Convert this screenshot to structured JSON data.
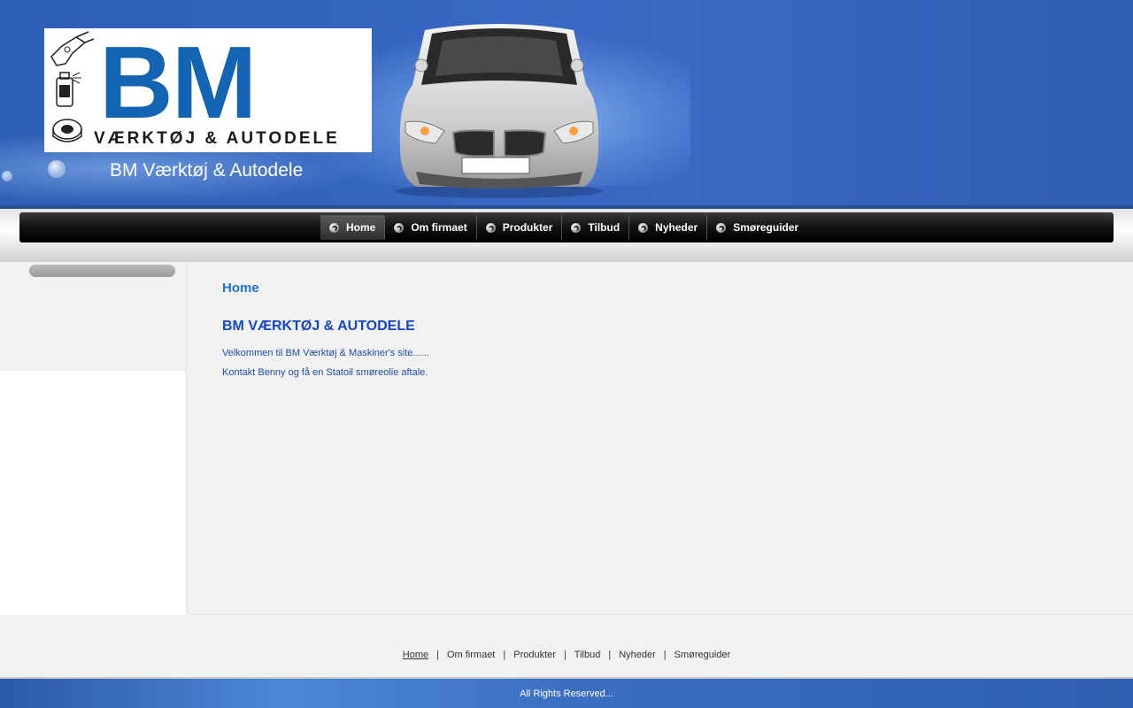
{
  "header": {
    "logo_text": "BM",
    "logo_subtitle": "VÆRKTØJ & AUTODELE",
    "site_name": "BM Værktøj & Autodele"
  },
  "nav": {
    "items": [
      {
        "label": "Home",
        "active": true
      },
      {
        "label": "Om firmaet"
      },
      {
        "label": "Produkter"
      },
      {
        "label": "Tilbud"
      },
      {
        "label": "Nyheder"
      },
      {
        "label": "Smøreguider"
      }
    ]
  },
  "main": {
    "page_title": "Home",
    "heading": "BM VÆRKTØJ & AUTODELE",
    "paragraphs": [
      "Velkommen til BM Værktøj & Maskiner's site......",
      "Kontakt Benny og få en Statoil smøreolie aftale."
    ]
  },
  "footer": {
    "links": [
      "Home",
      "Om firmaet",
      "Produkter",
      "Tilbud",
      "Nyheder",
      "Smøreguider"
    ],
    "copyright": "All Rights Reserved..."
  },
  "colors": {
    "header_blue": "#3566c0",
    "title_blue": "#1b75d0",
    "heading_blue": "#1346c8",
    "logo_blue": "#1464b4"
  }
}
